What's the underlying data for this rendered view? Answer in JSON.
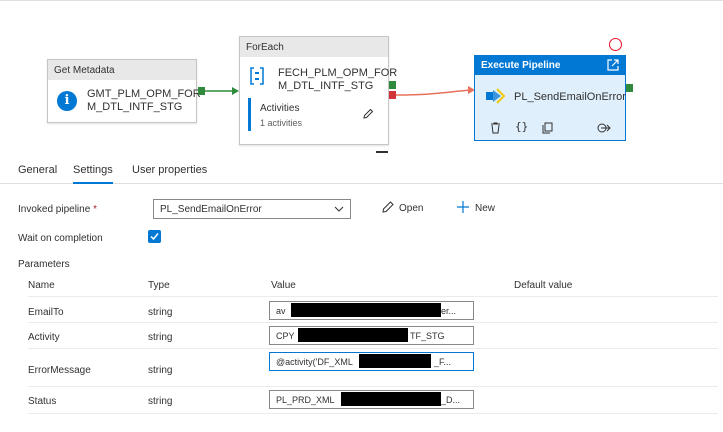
{
  "pipeline": {
    "get_metadata": {
      "header": "Get Metadata",
      "name_line1": "GMT_PLM_OPM_FOR",
      "name_line2": "M_DTL_INTF_STG"
    },
    "foreach": {
      "header": "ForEach",
      "name_line1": "FECH_PLM_OPM_FOR",
      "name_line2": "M_DTL_INTF_STG",
      "activities_label": "Activities",
      "activities_count": "1 activities"
    },
    "execute_pipeline": {
      "header": "Execute Pipeline",
      "name": "PL_SendEmailOnError"
    }
  },
  "tabs": [
    {
      "label": "General"
    },
    {
      "label": "Settings"
    },
    {
      "label": "User properties"
    }
  ],
  "settings": {
    "invoked_pipeline_label": "Invoked pipeline",
    "required_mark": "*",
    "invoked_pipeline_value": "PL_SendEmailOnError",
    "open_label": "Open",
    "new_label": "New",
    "wait_label": "Wait on completion",
    "wait_checked": true,
    "parameters_title": "Parameters",
    "columns": {
      "name": "Name",
      "type": "Type",
      "value": "Value",
      "default": "Default value"
    },
    "params": [
      {
        "name": "EmailTo",
        "type": "string",
        "value_prefix": "av",
        "value_suffix": "er..."
      },
      {
        "name": "Activity",
        "type": "string",
        "value_prefix": "CPY",
        "value_suffix": "TF_STG"
      },
      {
        "name": "ErrorMessage",
        "type": "string",
        "value_prefix": "@activity('DF_XML",
        "value_suffix": "_F..."
      },
      {
        "name": "Status",
        "type": "string",
        "value_prefix": "PL_PRD_XML",
        "value_suffix": "_D..."
      }
    ]
  },
  "colors": {
    "accent": "#0078d4",
    "success": "#2f8a3b",
    "failure": "#d13438"
  }
}
